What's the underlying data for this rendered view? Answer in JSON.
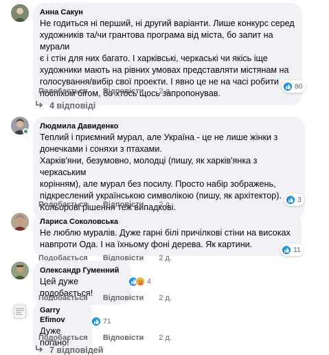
{
  "comments": [
    {
      "author": "Анна Сакун",
      "lines": [
        "Не годиться ні перший, ні другий варіанти. Лише конкурс серед",
        "художників та/чи грантова програма від міста, бо запит на мурали",
        "є і стін для них багато. І харківські, черкаські чи якісь іще",
        "художники мають на рівних умовах представляти містянам на",
        "голосування/вибір свої проекти. І явно це не на часі робити",
        "поспіхом бігом, бо хтось щось запропонував."
      ],
      "like_label": "Подобається",
      "reply_label": "Відповісти",
      "time": "2 д.",
      "reaction_count": "80",
      "replies_label": "4 відповіді"
    },
    {
      "author": "Людмила Давиденко",
      "lines": [
        "Теплий і приємний мурал, але Україна - це не лише жінки з",
        "донечками і соняхи з птахами.",
        "Харків'яни, безумовно, молодці (пишу, як харків'янка з черкаським",
        "корінням), але мурал без посилу. Просто набір зображень,",
        "підкреслений українською символікою (пишу, як архітектор).",
        "Кольорові рішення теж випадкові."
      ],
      "like_label": "Подобається",
      "reply_label": "Відповісти",
      "time": "2 д.",
      "reaction_count": "3"
    },
    {
      "author": "Лариса Соколовська",
      "lines": [
        "Не люблю муралів. Дуже гарні білі причілкові стіни на високах",
        "навпроти Ода. І на їхньому фоні дерева. Як картини."
      ],
      "like_label": "Подобається",
      "reply_label": "Відповісти",
      "time": "2 д.",
      "reaction_count": "11"
    },
    {
      "author": "Олександр Гуменний",
      "lines": [
        "Цей дуже подобається!"
      ],
      "like_label": "Подобається",
      "reply_label": "Відповісти",
      "time": "2 д.",
      "reaction_count": "4"
    },
    {
      "author": "Garry Efimov",
      "lines": [
        "Дуже погано!"
      ],
      "like_label": "Подобається",
      "reply_label": "Відповісти",
      "time": "2 д.",
      "reaction_count": "71",
      "replies_label": "7 відповідей"
    }
  ],
  "colors": {
    "bubble": "#f0f2f5",
    "meta_text": "#65676b",
    "like_blue": "#0866ff",
    "online_green": "#31a24c"
  }
}
